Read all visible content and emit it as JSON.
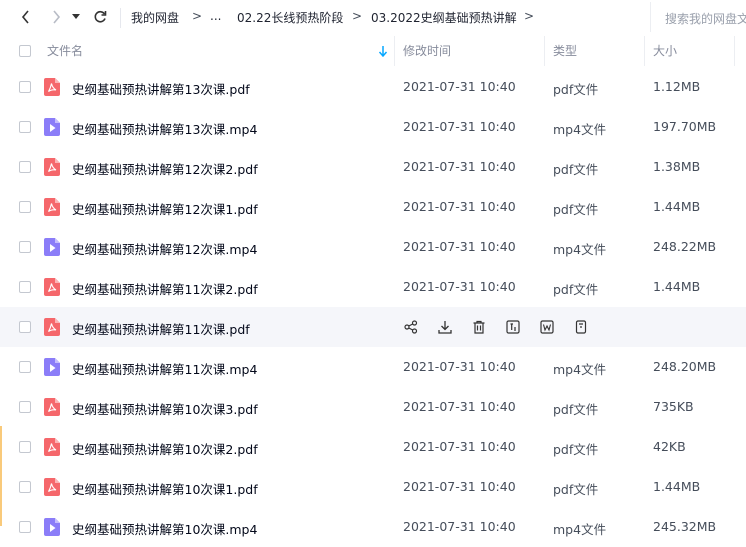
{
  "nav": {
    "breadcrumb": [
      "我的网盘",
      ">",
      "...",
      "02.22长线预热阶段",
      ">",
      "03.2022史纲基础预热讲解",
      ">"
    ],
    "search_placeholder": "搜索我的网盘文件"
  },
  "header": {
    "name": "文件名",
    "modified": "修改时间",
    "type": "类型",
    "size": "大小"
  },
  "files": [
    {
      "name": "史纲基础预热讲解第13次课.pdf",
      "date": "2021-07-31 10:40",
      "type": "pdf文件",
      "size": "1.12MB",
      "icon": "pdf-icon"
    },
    {
      "name": "史纲基础预热讲解第13次课.mp4",
      "date": "2021-07-31 10:40",
      "type": "mp4文件",
      "size": "197.70MB",
      "icon": "video-icon"
    },
    {
      "name": "史纲基础预热讲解第12次课2.pdf",
      "date": "2021-07-31 10:40",
      "type": "pdf文件",
      "size": "1.38MB",
      "icon": "pdf-icon"
    },
    {
      "name": "史纲基础预热讲解第12次课1.pdf",
      "date": "2021-07-31 10:40",
      "type": "pdf文件",
      "size": "1.44MB",
      "icon": "pdf-icon"
    },
    {
      "name": "史纲基础预热讲解第12次课.mp4",
      "date": "2021-07-31 10:40",
      "type": "mp4文件",
      "size": "248.22MB",
      "icon": "video-icon"
    },
    {
      "name": "史纲基础预热讲解第11次课2.pdf",
      "date": "2021-07-31 10:40",
      "type": "pdf文件",
      "size": "1.44MB",
      "icon": "pdf-icon"
    },
    {
      "name": "史纲基础预热讲解第11次课.pdf",
      "date": "",
      "type": "",
      "size": "",
      "icon": "pdf-icon",
      "hover": true
    },
    {
      "name": "史纲基础预热讲解第11次课.mp4",
      "date": "2021-07-31 10:40",
      "type": "mp4文件",
      "size": "248.20MB",
      "icon": "video-icon"
    },
    {
      "name": "史纲基础预热讲解第10次课3.pdf",
      "date": "2021-07-31 10:40",
      "type": "pdf文件",
      "size": "735KB",
      "icon": "pdf-icon"
    },
    {
      "name": "史纲基础预热讲解第10次课2.pdf",
      "date": "2021-07-31 10:40",
      "type": "pdf文件",
      "size": "42KB",
      "icon": "pdf-icon"
    },
    {
      "name": "史纲基础预热讲解第10次课1.pdf",
      "date": "2021-07-31 10:40",
      "type": "pdf文件",
      "size": "1.44MB",
      "icon": "pdf-icon"
    },
    {
      "name": "史纲基础预热讲解第10次课.mp4",
      "date": "2021-07-31 10:40",
      "type": "mp4文件",
      "size": "245.32MB",
      "icon": "video-icon"
    }
  ],
  "row_actions": [
    "share-icon",
    "download-icon",
    "delete-icon",
    "text-convert-icon",
    "word-convert-icon",
    "more-icon"
  ],
  "colors": {
    "pdf": "#f5676b",
    "video": "#8b7df8",
    "accent": "#06a7ff"
  }
}
